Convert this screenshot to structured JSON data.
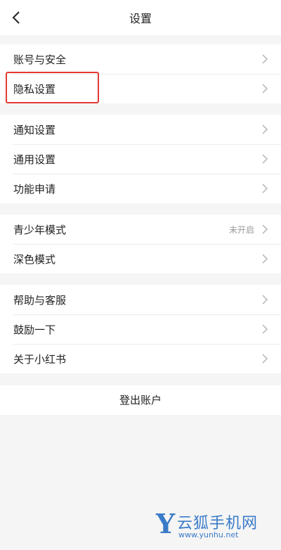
{
  "header": {
    "title": "设置",
    "back_icon": "chevron-left-icon"
  },
  "group1": [
    {
      "label": "账号与安全"
    },
    {
      "label": "隐私设置"
    }
  ],
  "group2": [
    {
      "label": "通知设置"
    },
    {
      "label": "通用设置"
    },
    {
      "label": "功能申请"
    }
  ],
  "group3": [
    {
      "label": "青少年模式",
      "value": "未开启"
    },
    {
      "label": "深色模式"
    }
  ],
  "group4": [
    {
      "label": "帮助与客服"
    },
    {
      "label": "鼓励一下"
    },
    {
      "label": "关于小红书"
    }
  ],
  "logout": {
    "label": "登出账户"
  },
  "highlight_color": "#e53935",
  "watermark": {
    "brand_letter": "Y",
    "brand_name": "云狐手机网",
    "url": "www.yunhu.net",
    "color": "#3a7bc8"
  }
}
